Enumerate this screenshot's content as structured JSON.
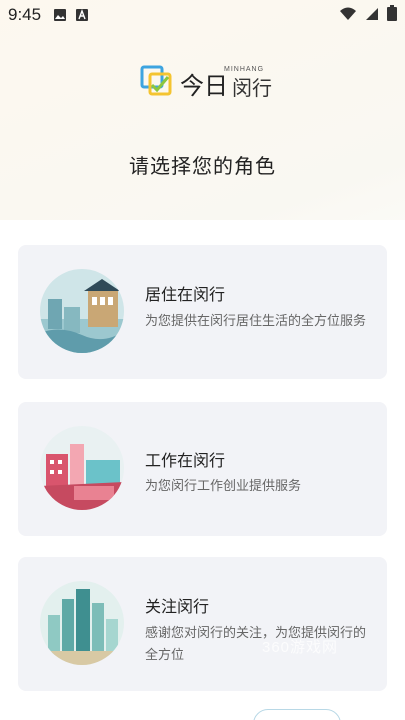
{
  "status_bar": {
    "time": "9:45",
    "left_icons": [
      "image-icon",
      "a-letter-icon"
    ],
    "right_icons": [
      "wifi-icon",
      "signal-icon",
      "battery-icon"
    ]
  },
  "logo": {
    "cn_prefix": "今日",
    "cn_name": "闵行",
    "en_name": "MINHANG",
    "icon": "minhang-logo-icon"
  },
  "page_title": "请选择您的角色",
  "roles": [
    {
      "title": "居住在闵行",
      "description": "为您提供在闵行居住生活的全方位服务",
      "icon": "residential-buildings-illustration"
    },
    {
      "title": "工作在闵行",
      "description": "为您闵行工作创业提供服务",
      "icon": "workplace-buildings-illustration"
    },
    {
      "title": "关注闵行",
      "description": "感谢您对闵行的关注，为您提供闵行的全方位",
      "icon": "skyline-illustration"
    }
  ],
  "watermark": "360游戏网",
  "colors": {
    "card_bg": "#f2f3f7",
    "logo_blue": "#3da4e0",
    "logo_yellow": "#f4c430",
    "logo_green": "#8cc63f"
  }
}
